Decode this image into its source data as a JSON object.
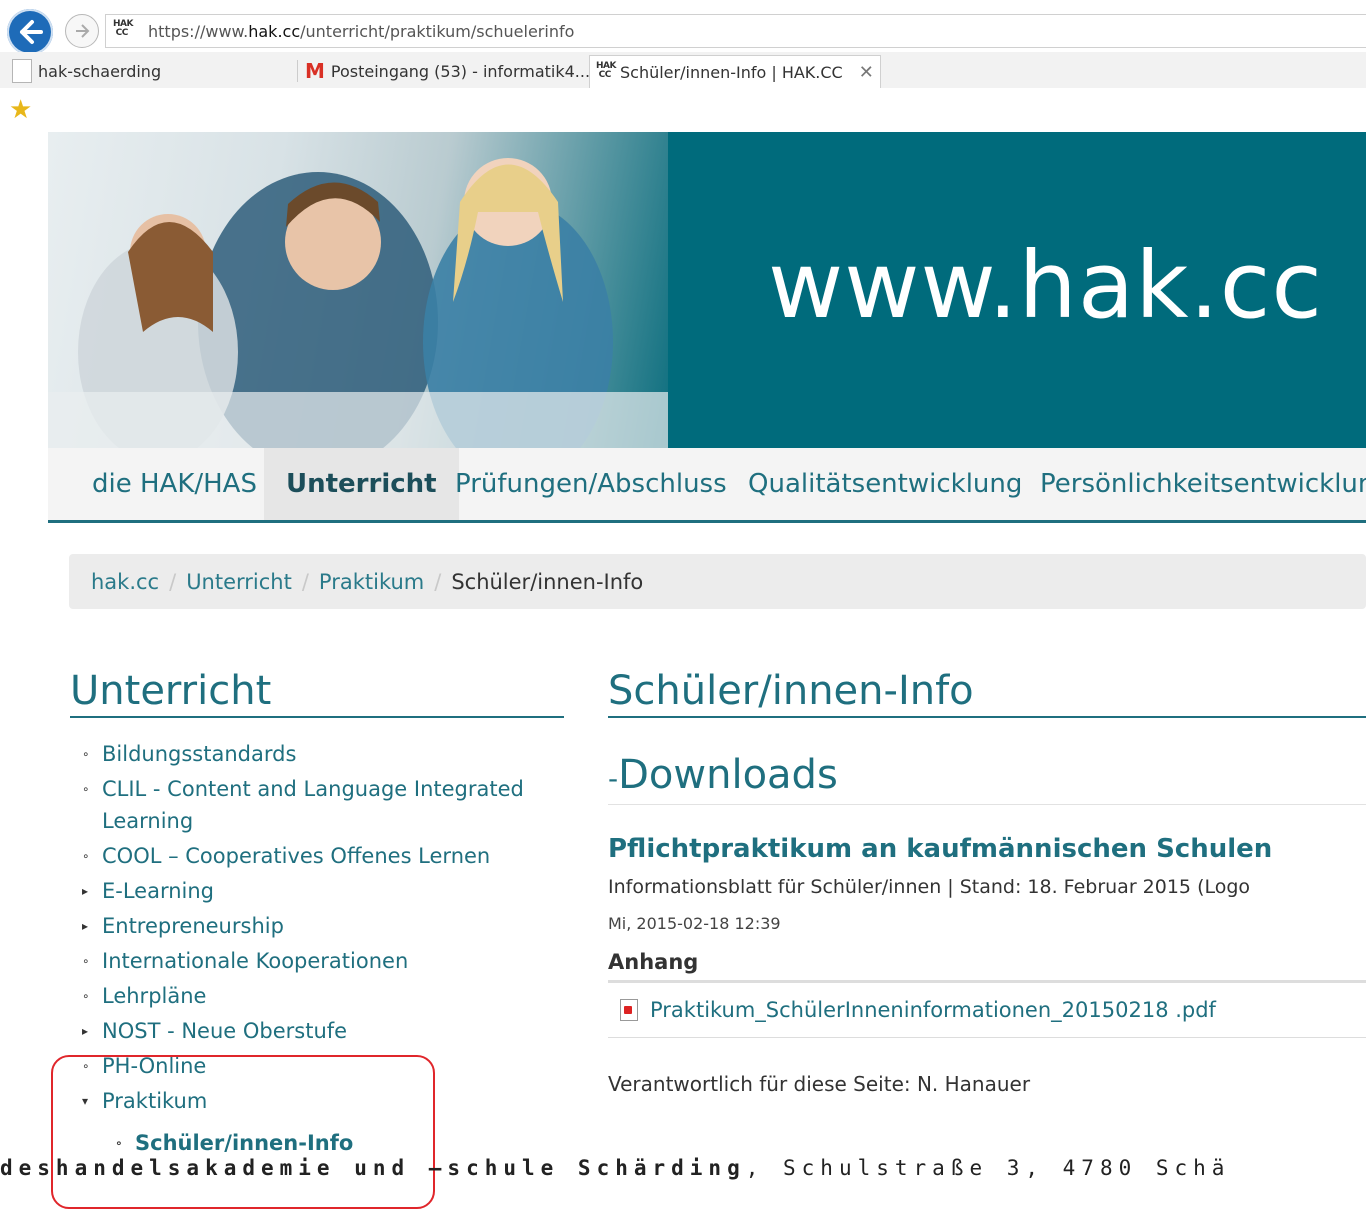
{
  "browser": {
    "url": "https://www.hak.cc/unterricht/praktikum/schuelerinfo",
    "url_prefix": "https://www.",
    "url_domain": "hak.cc",
    "url_path": "/unterricht/praktikum/schuelerinfo",
    "favicon_text": "HAK CC",
    "tabs": [
      {
        "label": "hak-schaerding"
      },
      {
        "label": "Posteingang (53) - informatik4..."
      },
      {
        "label": "Schüler/innen-Info | HAK.CC"
      }
    ]
  },
  "site": {
    "title": "www.hak.cc",
    "nav": [
      {
        "label": "die HAK/HAS"
      },
      {
        "label": "Unterricht"
      },
      {
        "label": "Prüfungen/Abschluss"
      },
      {
        "label": "Qualitätsentwicklung"
      },
      {
        "label": "Persönlichkeitsentwicklung"
      }
    ],
    "breadcrumb": [
      "hak.cc",
      "Unterricht",
      "Praktikum"
    ],
    "breadcrumb_current": "Schüler/innen-Info"
  },
  "sidebar": {
    "title": "Unterricht",
    "items": [
      {
        "label": "Bildungsstandards",
        "bullet": "∘"
      },
      {
        "label": "CLIL - Content and Language Integrated",
        "label2": "Learning",
        "bullet": "∘"
      },
      {
        "label": "COOL – Cooperatives Offenes Lernen",
        "bullet": "∘"
      },
      {
        "label": "E-Learning",
        "bullet": "▸"
      },
      {
        "label": "Entrepreneurship",
        "bullet": "▸"
      },
      {
        "label": "Internationale Kooperationen",
        "bullet": "∘"
      },
      {
        "label": "Lehrpläne",
        "bullet": "∘"
      },
      {
        "label": "NOST - Neue Oberstufe",
        "bullet": "▸"
      },
      {
        "label": "PH-Online",
        "bullet": "∘"
      },
      {
        "label": "Praktikum",
        "bullet": "▾"
      }
    ],
    "subitem": {
      "label": "Schüler/innen-Info",
      "bullet": "∘"
    }
  },
  "content": {
    "title": "Schüler/innen-Info",
    "section": "Downloads",
    "section_marker": "-",
    "node_title": "Pflichtpraktikum an kaufmännischen Schulen",
    "node_body": "Informationsblatt für Schüler/innen | Stand: 18. Februar 2015 (Logo",
    "node_date": "Mi, 2015-02-18 12:39",
    "attachment_label": "Anhang",
    "attachment_file": "Praktikum_SchülerInneninformationen_20150218 .pdf",
    "responsible": "Verantwortlich für diese Seite: N. Hanauer"
  },
  "footer": {
    "text_bold": "deshandelsakademie und –schule Schärding",
    "text_rest": ", Schulstraße 3, 4780 Schä"
  },
  "colors": {
    "accent": "#1f6f7f",
    "banner": "#006b7c",
    "highlight": "#e0262b"
  }
}
